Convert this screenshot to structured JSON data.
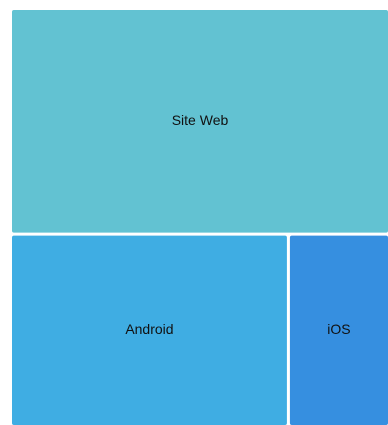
{
  "chart_data": {
    "type": "treemap",
    "items": [
      {
        "label": "Site Web",
        "value": 54,
        "color": "#62C2D2"
      },
      {
        "label": "Android",
        "value": 34,
        "color": "#3FADE3"
      },
      {
        "label": "iOS",
        "value": 12,
        "color": "#368FE0"
      }
    ]
  }
}
